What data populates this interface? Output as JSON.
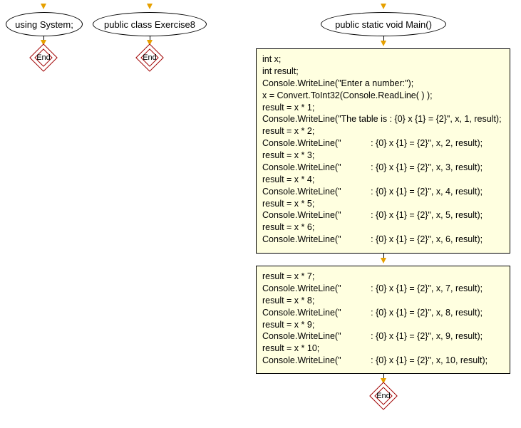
{
  "nodes": {
    "ellipse1": "using System;",
    "ellipse2": "public class Exercise8",
    "ellipse3": "public static void Main()",
    "end": "End"
  },
  "code1": "int x;\nint result;\nConsole.WriteLine(\"Enter a number:\");\nx = Convert.ToInt32(Console.ReadLine( ) );\nresult = x * 1;\nConsole.WriteLine(\"The table is : {0} x {1} = {2}\", x, 1, result);\nresult = x * 2;\nConsole.WriteLine(\"            : {0} x {1} = {2}\", x, 2, result);\nresult = x * 3;\nConsole.WriteLine(\"            : {0} x {1} = {2}\", x, 3, result);\nresult = x * 4;\nConsole.WriteLine(\"            : {0} x {1} = {2}\", x, 4, result);\nresult = x * 5;\nConsole.WriteLine(\"            : {0} x {1} = {2}\", x, 5, result);\nresult = x * 6;\nConsole.WriteLine(\"            : {0} x {1} = {2}\", x, 6, result);",
  "code2": "result = x * 7;\nConsole.WriteLine(\"            : {0} x {1} = {2}\", x, 7, result);\nresult = x * 8;\nConsole.WriteLine(\"            : {0} x {1} = {2}\", x, 8, result);\nresult = x * 9;\nConsole.WriteLine(\"            : {0} x {1} = {2}\", x, 9, result);\nresult = x * 10;\nConsole.WriteLine(\"            : {0} x {1} = {2}\", x, 10, result);"
}
